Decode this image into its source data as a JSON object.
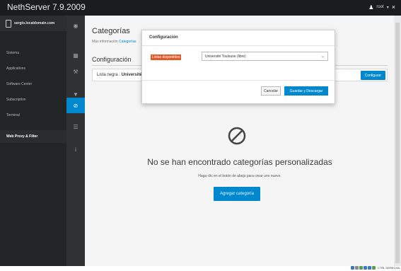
{
  "app": {
    "title": "NethServer 7.9.2009",
    "user": "root"
  },
  "sidebar": {
    "hostname": "sergio.localdomain.com",
    "items": [
      {
        "label": "Sistema"
      },
      {
        "label": "Applications"
      },
      {
        "label": "Software Center"
      },
      {
        "label": "Subscription"
      },
      {
        "label": "Terminal"
      },
      {
        "label": "Web Proxy & Filter"
      }
    ]
  },
  "page": {
    "title": "Categorías",
    "subtitle_prefix": "Más información",
    "subtitle_link": "Categorías",
    "section": "Configuración",
    "list_label": "Lista negra",
    "list_value": "Université",
    "configure_button": "Configurar"
  },
  "empty": {
    "title": "No se han encontrado categorías personalizadas",
    "help": "Haga clic en el botón de abajo para crear uno nuevo.",
    "add_button": "Agregar categoría"
  },
  "modal": {
    "title": "Configuración",
    "field_label": "Listas disponibles",
    "select_value": "Université Toulouse (libre)",
    "cancel": "Cancelar",
    "save": "Guardar y Descargar"
  },
  "tray": {
    "text": "CTRL DERECHA"
  },
  "colors": {
    "accent": "#0088ce",
    "highlight": "#e05a28",
    "sidebar": "#222426"
  },
  "icons": [
    "server-icon",
    "user-icon",
    "wrench-icon",
    "filter-icon",
    "block-icon",
    "list-icon",
    "info-icon",
    "prohibited-icon"
  ]
}
